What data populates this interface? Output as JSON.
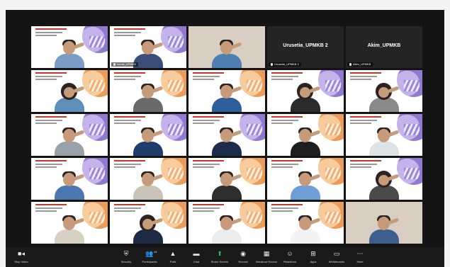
{
  "meeting": {
    "tiles": [
      {
        "type": "video",
        "name": "",
        "theme": "purple",
        "shirt": "#7a9cc6"
      },
      {
        "type": "video",
        "name": "Ismail_UPMKB",
        "theme": "purple",
        "shirt": "#3b4e7a"
      },
      {
        "type": "video",
        "name": "",
        "theme": "none",
        "shirt": "#4d7fb3"
      },
      {
        "type": "name",
        "name": "Urusetia_UPMKB 2",
        "label": "Urusetia_UPMKB 2"
      },
      {
        "type": "name",
        "name": "Akim_UPMKB",
        "label": "Akim_UPMKB"
      },
      {
        "type": "video",
        "name": "",
        "theme": "orange",
        "shirt": "#5e8fb8",
        "hijab": true
      },
      {
        "type": "video",
        "name": "",
        "theme": "orange",
        "shirt": "#6a6a6a"
      },
      {
        "type": "video",
        "name": "",
        "theme": "orange",
        "shirt": "#2f5f9a"
      },
      {
        "type": "video",
        "name": "",
        "theme": "purple",
        "shirt": "#2b2b2b",
        "hijab": true
      },
      {
        "type": "video",
        "name": "",
        "theme": "purple",
        "shirt": "#8a8a8a",
        "hijab": true
      },
      {
        "type": "video",
        "name": "",
        "theme": "purple",
        "shirt": "#9aa0a8"
      },
      {
        "type": "video",
        "name": "",
        "theme": "purple",
        "shirt": "#1f3d6b"
      },
      {
        "type": "video",
        "name": "",
        "theme": "purple",
        "shirt": "#1c2c4a"
      },
      {
        "type": "video",
        "name": "",
        "theme": "orange",
        "shirt": "#1e1e1e"
      },
      {
        "type": "video",
        "name": "",
        "theme": "purple",
        "shirt": "#dfe3e8"
      },
      {
        "type": "video",
        "name": "",
        "theme": "purple",
        "shirt": "#4b78b0"
      },
      {
        "type": "video",
        "name": "",
        "theme": "orange",
        "shirt": "#c8c3b6"
      },
      {
        "type": "video",
        "name": "",
        "theme": "orange",
        "shirt": "#2d2d2d"
      },
      {
        "type": "video",
        "name": "",
        "theme": "orange",
        "shirt": "#6d9ed6"
      },
      {
        "type": "video",
        "name": "",
        "theme": "purple",
        "shirt": "#4a4a4a",
        "hijab": true
      },
      {
        "type": "video",
        "name": "",
        "theme": "orange",
        "shirt": "#d9d0c4"
      },
      {
        "type": "video",
        "name": "",
        "theme": "orange",
        "shirt": "#1d2a44",
        "hijab": true
      },
      {
        "type": "video",
        "name": "",
        "theme": "orange",
        "shirt": "#ececec"
      },
      {
        "type": "video",
        "name": "",
        "theme": "orange",
        "shirt": "#f3f3f3"
      },
      {
        "type": "video",
        "name": "",
        "theme": "none",
        "shirt": "#3e5f8e"
      }
    ]
  },
  "toolbar": {
    "left": {
      "label": "Stop Video",
      "icon": "video-camera-icon"
    },
    "items": [
      {
        "id": "security",
        "label": "Security",
        "icon": "shield-icon",
        "glyph": "⛨"
      },
      {
        "id": "participants",
        "label": "Participants",
        "icon": "participants-icon",
        "glyph": "👥",
        "count": "26"
      },
      {
        "id": "polls",
        "label": "Polls",
        "icon": "poll-icon",
        "glyph": "▲"
      },
      {
        "id": "chat",
        "label": "Chat",
        "icon": "chat-icon",
        "glyph": "▬"
      },
      {
        "id": "share",
        "label": "Share Screen",
        "icon": "share-screen-icon",
        "glyph": "⬆",
        "green": true
      },
      {
        "id": "record",
        "label": "Record",
        "icon": "record-icon",
        "glyph": "◉"
      },
      {
        "id": "breakout",
        "label": "Breakout Rooms",
        "icon": "breakout-rooms-icon",
        "glyph": "▦"
      },
      {
        "id": "reactions",
        "label": "Reactions",
        "icon": "reactions-icon",
        "glyph": "☺"
      },
      {
        "id": "apps",
        "label": "Apps",
        "icon": "apps-icon",
        "glyph": "⊞"
      },
      {
        "id": "whiteboards",
        "label": "Whiteboards",
        "icon": "whiteboard-icon",
        "glyph": "▭"
      },
      {
        "id": "more",
        "label": "More",
        "icon": "more-icon",
        "glyph": "⋯"
      }
    ]
  }
}
